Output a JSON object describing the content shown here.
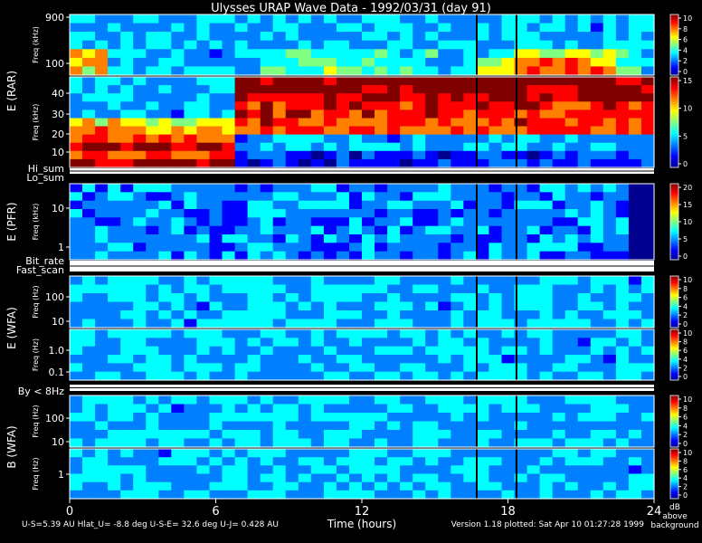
{
  "title": "Ulysses URAP Wave Data - 1992/03/31  (day 91)",
  "chart_data": {
    "type": "heatmap",
    "title": "Ulysses URAP Wave Data - 1992/03/31  (day 91)",
    "xlabel": "Time (hours)",
    "xlim": [
      0,
      24
    ],
    "x_ticks": [
      "0",
      "6",
      "12",
      "18",
      "24"
    ],
    "panels": [
      {
        "id": "rar-high",
        "group_label": "E (RAR)",
        "ylabel": "Freq (kHz)",
        "y_ticks": [
          "900",
          "100"
        ],
        "cbar_ticks": [
          "10",
          "8",
          "6",
          "4",
          "2",
          "0"
        ]
      },
      {
        "id": "rar-low",
        "group_label": "E (RAR)",
        "ylabel": "Freq (kHz)",
        "y_ticks": [
          "40",
          "30",
          "20",
          "10"
        ],
        "cbar_ticks": [
          "15",
          "10",
          "5",
          "0"
        ]
      },
      {
        "id": "pfr",
        "group_label": "E (PFR)",
        "ylabel": "Freq (kHz)",
        "y_ticks": [
          "10",
          "1"
        ],
        "cbar_ticks": [
          "20",
          "15",
          "10",
          "5",
          "0"
        ]
      },
      {
        "id": "wfa-e-high",
        "group_label": "E (WFA)",
        "ylabel": "Freq (Hz)",
        "y_ticks": [
          "100",
          "10"
        ],
        "cbar_ticks": [
          "10",
          "8",
          "6",
          "4",
          "2",
          "0"
        ]
      },
      {
        "id": "wfa-e-low",
        "group_label": "E (WFA)",
        "ylabel": "Freq (Hz)",
        "y_ticks": [
          "1.0",
          "0.1"
        ],
        "cbar_ticks": [
          "10",
          "8",
          "6",
          "4",
          "2",
          "0"
        ]
      },
      {
        "id": "wfa-b-high",
        "group_label": "B (WFA)",
        "ylabel": "Freq (Hz)",
        "y_ticks": [
          "100",
          "10"
        ],
        "cbar_ticks": [
          "10",
          "8",
          "6",
          "4",
          "2",
          "0"
        ]
      },
      {
        "id": "wfa-b-low",
        "group_label": "B (WFA)",
        "ylabel": "Freq (Hz)",
        "y_ticks": [
          "1"
        ],
        "cbar_ticks": [
          "10",
          "8",
          "6",
          "4",
          "2",
          "0"
        ]
      }
    ],
    "status_bars": [
      {
        "id": "sum",
        "labels": [
          "Hi_sum",
          "Lo_sum"
        ]
      },
      {
        "id": "rate",
        "labels": [
          "Bit_rate",
          "Fast_scan"
        ]
      },
      {
        "id": "lowfreq",
        "labels": [
          "By < 8Hz"
        ]
      }
    ],
    "colorbar_unit": [
      "dB",
      "above",
      "background"
    ],
    "colormap": [
      "#00008f",
      "#0000ff",
      "#0080ff",
      "#00ffff",
      "#80ff80",
      "#ffff00",
      "#ff8000",
      "#ff0000",
      "#800000"
    ],
    "grid": false
  },
  "footer": {
    "left": "U-S=5.39 AU  Hlat_U= -8.8 deg  U-S-E= 32.6 deg  U-J= 0.428 AU",
    "right": "Version 1.18 plotted: Sat Apr 10 01:27:28 1999"
  }
}
